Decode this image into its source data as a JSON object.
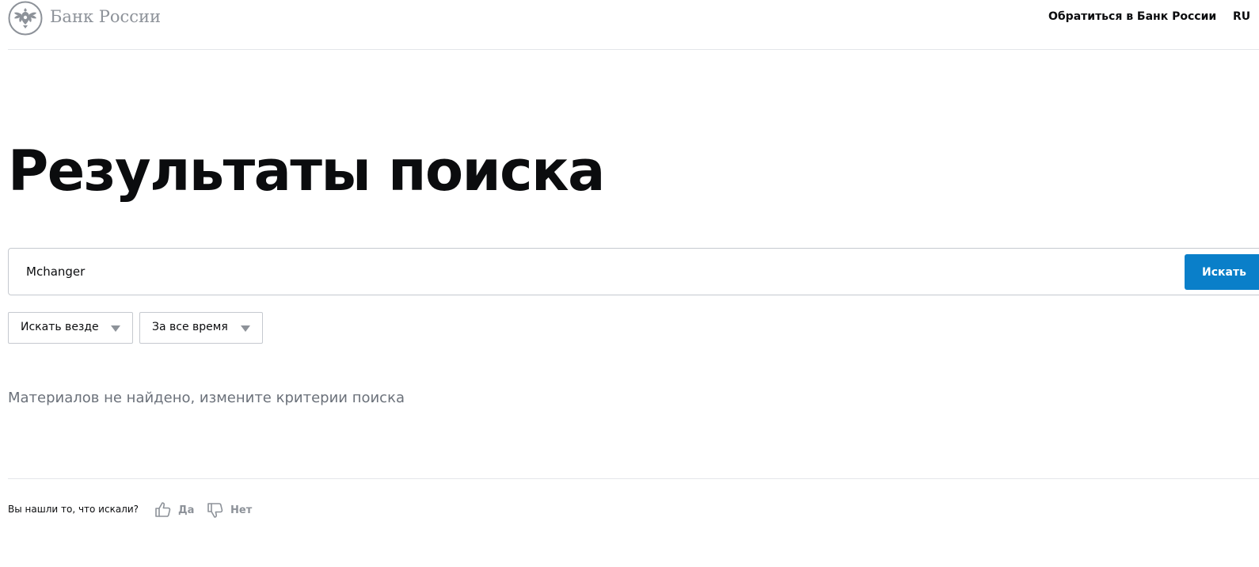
{
  "header": {
    "logo_text": "Банк России",
    "contact_link": "Обратиться в Банк России",
    "language": "RU"
  },
  "main": {
    "title": "Результаты поиска",
    "search": {
      "value": "Mchanger",
      "button_label": "Искать"
    },
    "filters": {
      "scope": "Искать везде",
      "period": "За все время"
    },
    "empty_message": "Материалов не найдено, измените критерии поиска"
  },
  "feedback": {
    "question": "Вы нашли то, что искали?",
    "yes_label": "Да",
    "no_label": "Нет",
    "yes_icon": "thumbs-up-icon",
    "no_icon": "thumbs-down-icon"
  },
  "colors": {
    "accent": "#0a7fc9",
    "muted_text": "#6b717a",
    "logo_gray": "#8d9299"
  }
}
